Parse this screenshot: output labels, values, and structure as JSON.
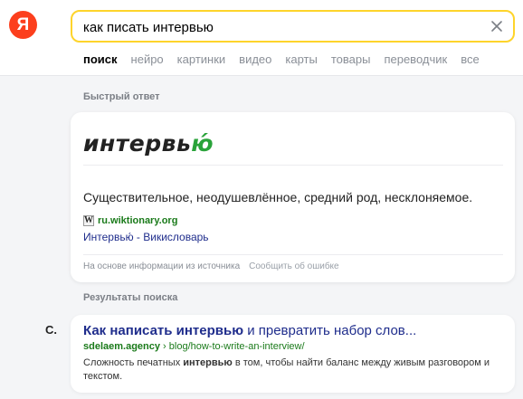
{
  "header": {
    "logo_letter": "Я",
    "search": {
      "value": "как писать интервью",
      "placeholder": ""
    },
    "tabs": [
      {
        "label": "поиск",
        "active": true
      },
      {
        "label": "нейро",
        "active": false
      },
      {
        "label": "картинки",
        "active": false
      },
      {
        "label": "видео",
        "active": false
      },
      {
        "label": "карты",
        "active": false
      },
      {
        "label": "товары",
        "active": false
      },
      {
        "label": "переводчик",
        "active": false
      },
      {
        "label": "все",
        "active": false
      }
    ]
  },
  "quick_answer": {
    "section_label": "Быстрый ответ",
    "word_main": "интервь",
    "word_accent": "ю́",
    "definition": "Существительное, неодушевлённое, средний род, несклоняемое.",
    "source_icon": "W",
    "source_domain": "ru.wiktionary.org",
    "source_title": "Интервью́ - Викисловарь",
    "footer_text": "На основе информации из источника",
    "report_link": "Сообщить об ошибке"
  },
  "results": {
    "section_label": "Результаты поиска",
    "items": [
      {
        "favicon": "C.",
        "title_bold": "Как написать интервью",
        "title_rest": " и превратить набор слов...",
        "domain": "sdelaem.agency",
        "path": " › blog/how-to-write-an-interview/",
        "snippet_before": "Сложность печатных ",
        "snippet_bold": "интервью",
        "snippet_after": " в том, чтобы найти баланс между живым разговором и текстом."
      }
    ]
  },
  "colors": {
    "logo": "#fc3f1d",
    "search_border": "#fed42b",
    "link": "#1f2d8c",
    "url_green": "#1a7a1a",
    "accent_green": "#2aa33a"
  }
}
